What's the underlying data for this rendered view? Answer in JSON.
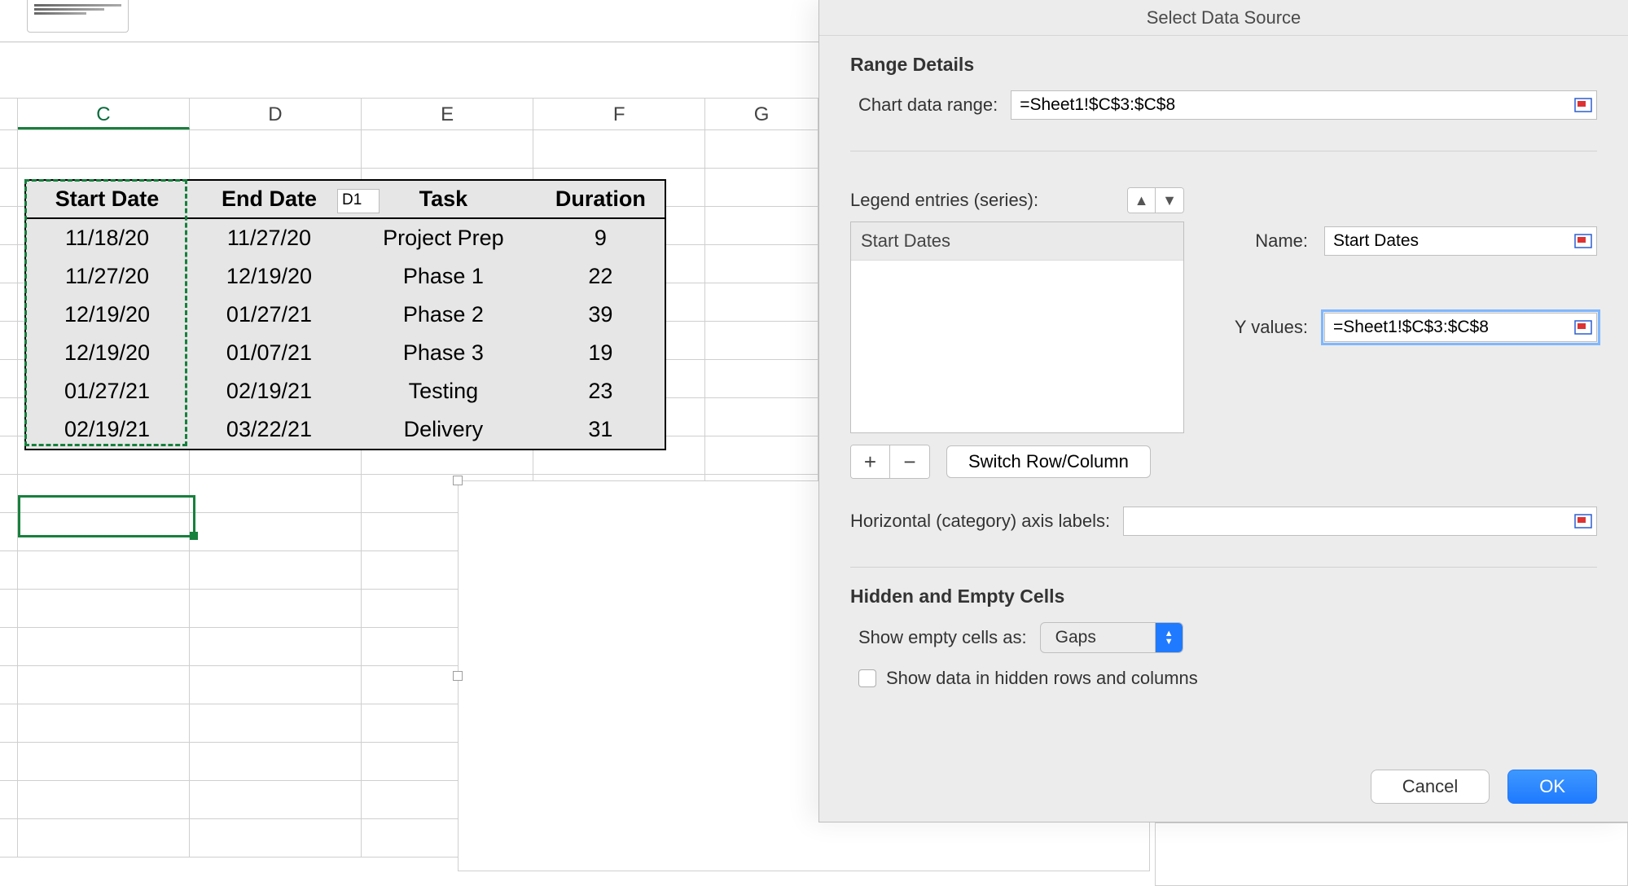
{
  "dialog": {
    "title": "Select Data Source",
    "range_details": {
      "heading": "Range Details",
      "chart_data_range_label": "Chart data range:",
      "chart_data_range_value": "=Sheet1!$C$3:$C$8"
    },
    "legend": {
      "label": "Legend entries (series):",
      "items": [
        "Start Dates"
      ]
    },
    "series_fields": {
      "name_label": "Name:",
      "name_value": "Start Dates",
      "yvalues_label": "Y values:",
      "yvalues_value": "=Sheet1!$C$3:$C$8"
    },
    "switch_label": "Switch Row/Column",
    "category_axis_label": "Horizontal (category) axis labels:",
    "category_axis_value": "",
    "hidden_heading": "Hidden and Empty Cells",
    "show_empty_label": "Show empty cells as:",
    "show_empty_value": "Gaps",
    "show_hidden_label": "Show data in hidden rows and columns",
    "cancel": "Cancel",
    "ok": "OK"
  },
  "sheet": {
    "columns": [
      "C",
      "D",
      "E",
      "F",
      "G"
    ],
    "namebox": "D1",
    "table": {
      "headers": {
        "c1": "Start Date",
        "c2": "End Date",
        "c3": "Task",
        "c4": "Duration"
      },
      "rows": [
        {
          "c1": "11/18/20",
          "c2": "11/27/20",
          "c3": "Project Prep",
          "c4": "9"
        },
        {
          "c1": "11/27/20",
          "c2": "12/19/20",
          "c3": "Phase 1",
          "c4": "22"
        },
        {
          "c1": "12/19/20",
          "c2": "01/27/21",
          "c3": "Phase 2",
          "c4": "39"
        },
        {
          "c1": "12/19/20",
          "c2": "01/07/21",
          "c3": "Phase 3",
          "c4": "19"
        },
        {
          "c1": "01/27/21",
          "c2": "02/19/21",
          "c3": "Testing",
          "c4": "23"
        },
        {
          "c1": "02/19/21",
          "c2": "03/22/21",
          "c3": "Delivery",
          "c4": "31"
        }
      ]
    }
  }
}
